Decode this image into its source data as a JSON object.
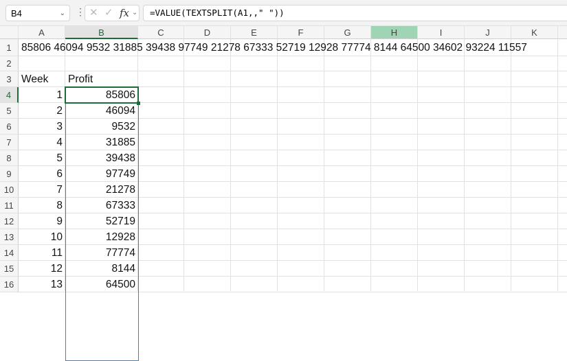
{
  "name_box": {
    "value": "B4"
  },
  "formula_bar": {
    "cancel_icon": "x-icon",
    "enter_icon": "check-icon",
    "fx_label": "fx",
    "value": "=VALUE(TEXTSPLIT(A1,,\" \"))"
  },
  "columns": [
    "A",
    "B",
    "C",
    "D",
    "E",
    "F",
    "G",
    "H",
    "I",
    "J",
    "K"
  ],
  "rows": [
    "1",
    "2",
    "3",
    "4",
    "5",
    "6",
    "7",
    "8",
    "9",
    "10",
    "11",
    "12",
    "13",
    "14",
    "15",
    "16"
  ],
  "cells": {
    "A1": "85806 46094 9532 31885 39438 97749 21278 67333 52719 12928 77774 8144 64500 34602 93224 11557",
    "A3": "Week",
    "B3": "Profit",
    "weeks": [
      "1",
      "2",
      "3",
      "4",
      "5",
      "6",
      "7",
      "8",
      "9",
      "10",
      "11",
      "12",
      "13"
    ],
    "profits": [
      "85806",
      "46094",
      "9532",
      "31885",
      "39438",
      "97749",
      "21278",
      "67333",
      "52719",
      "12928",
      "77774",
      "8144",
      "64500"
    ]
  },
  "selection": {
    "active_cell": "B4",
    "selected_column": "B",
    "highlighted_column": "H",
    "accent": "#1e6b3a"
  }
}
